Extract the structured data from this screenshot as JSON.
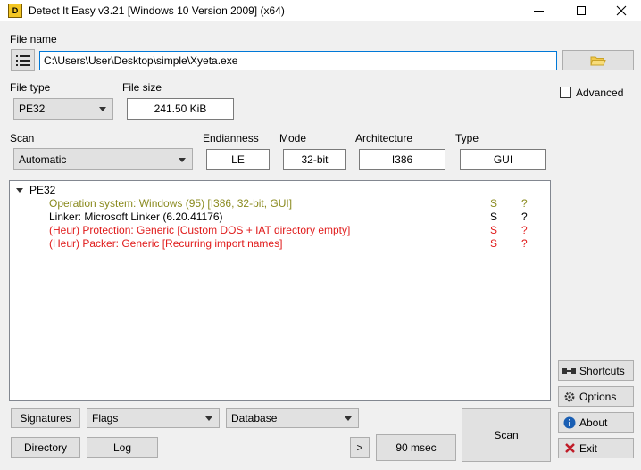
{
  "window": {
    "title": "Detect It Easy v3.21 [Windows 10 Version 2009] (x64)",
    "icon_text": "D"
  },
  "file": {
    "label": "File name",
    "path": "C:\\Users\\User\\Desktop\\simple\\Xyeta.exe"
  },
  "file_type": {
    "label": "File type",
    "value": "PE32"
  },
  "file_size": {
    "label": "File size",
    "value": "241.50 KiB"
  },
  "scan": {
    "label": "Scan",
    "value": "Automatic"
  },
  "endianness": {
    "label": "Endianness",
    "value": "LE"
  },
  "mode": {
    "label": "Mode",
    "value": "32-bit"
  },
  "architecture": {
    "label": "Architecture",
    "value": "I386"
  },
  "type": {
    "label": "Type",
    "value": "GUI"
  },
  "advanced": {
    "label": "Advanced",
    "checked": false
  },
  "results": {
    "root": "PE32",
    "items": [
      {
        "text": "Operation system: Windows (95) [I386, 32-bit, GUI]",
        "col1": "S",
        "col2": "?",
        "color": "#8a8a1e"
      },
      {
        "text": "Linker: Microsoft Linker (6.20.41176)",
        "col1": "S",
        "col2": "?",
        "color": "#000000"
      },
      {
        "text": "(Heur) Protection: Generic [Custom DOS + IAT directory empty]",
        "col1": "S",
        "col2": "?",
        "color": "#e01b1b"
      },
      {
        "text": "(Heur) Packer: Generic [Recurring import names]",
        "col1": "S",
        "col2": "?",
        "color": "#e01b1b"
      }
    ]
  },
  "bottom": {
    "signatures": "Signatures",
    "flags": "Flags",
    "database": "Database",
    "directory": "Directory",
    "log": "Log",
    "more": ">",
    "time": "90 msec",
    "scan": "Scan"
  },
  "side": {
    "shortcuts": "Shortcuts",
    "options": "Options",
    "about": "About",
    "exit": "Exit"
  }
}
